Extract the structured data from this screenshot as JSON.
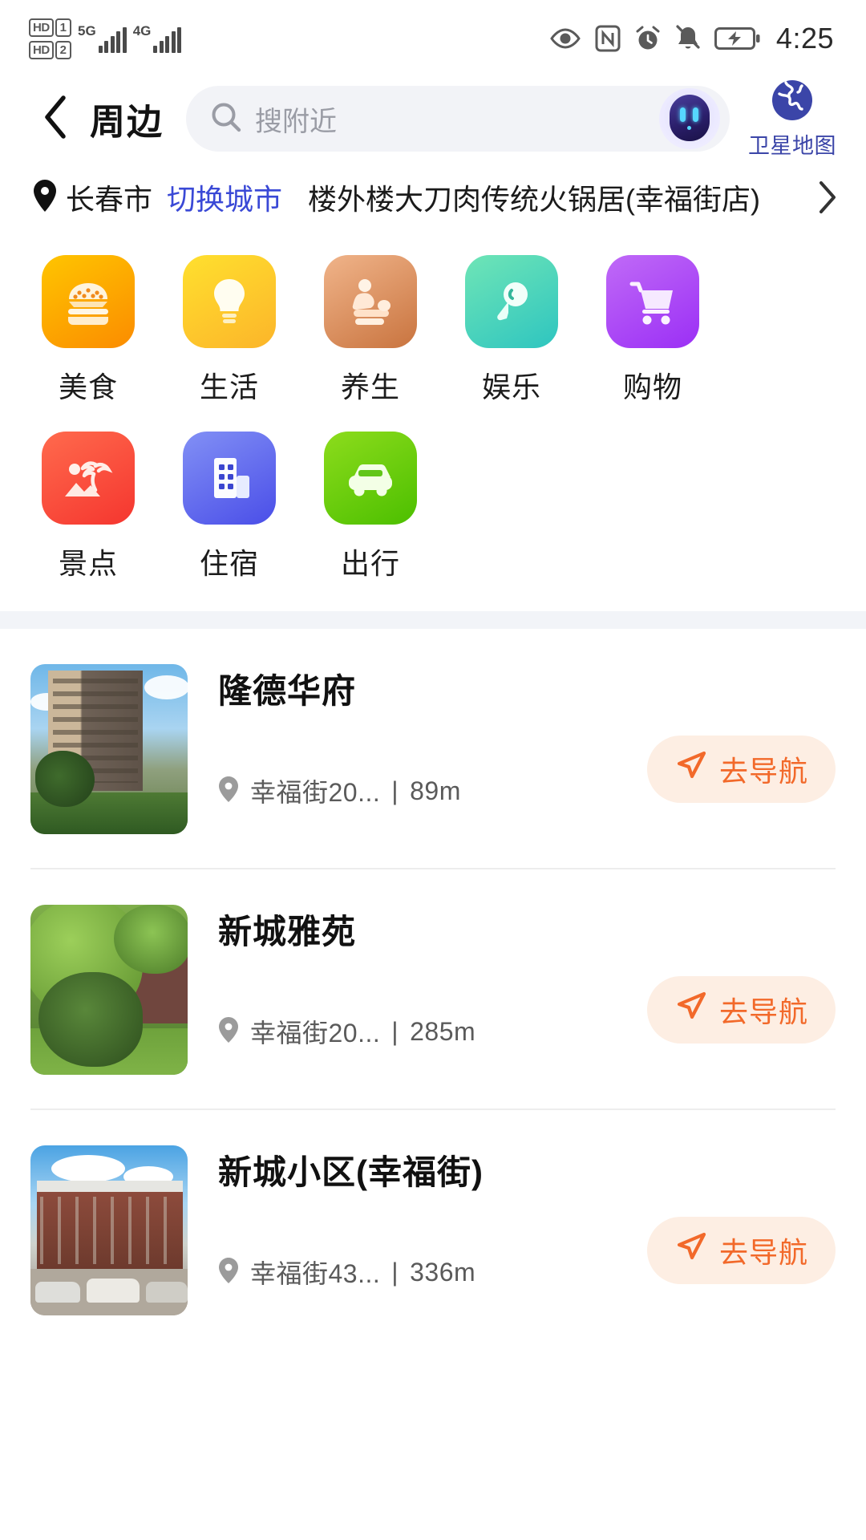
{
  "statusbar": {
    "sim1_hd": "HD",
    "sim1_num": "1",
    "sim2_hd": "HD",
    "sim2_num": "2",
    "net1": "5G",
    "net2": "4G",
    "time": "4:25",
    "icons": [
      "eye-care-icon",
      "nfc-icon",
      "alarm-icon",
      "bell-muted-icon",
      "battery-charging-icon"
    ]
  },
  "nav": {
    "back_icon": "chevron-left-icon",
    "title": "周边",
    "search": {
      "placeholder": "搜附近",
      "value": "",
      "icon": "search-icon",
      "assistant_icon": "ai-robot-icon"
    },
    "satellite": {
      "label": "卫星地图",
      "icon": "globe-icon"
    }
  },
  "location": {
    "pin_icon": "location-pin-icon",
    "city": "长春市",
    "switch_label": "切换城市",
    "poi": "楼外楼大刀肉传统火锅居(幸福街店)",
    "arrow_icon": "chevron-right-icon"
  },
  "categories": [
    {
      "label": "美食",
      "icon": "burger-icon",
      "color_start": "#ffc500",
      "color_end": "#fb8c00"
    },
    {
      "label": "生活",
      "icon": "lightbulb-icon",
      "color_start": "#ffe02e",
      "color_end": "#fcb52a"
    },
    {
      "label": "养生",
      "icon": "massage-icon",
      "color_start": "#f0b48a",
      "color_end": "#c9743f"
    },
    {
      "label": "娱乐",
      "icon": "microphone-icon",
      "color_start": "#6fe5b6",
      "color_end": "#2ec5c0"
    },
    {
      "label": "购物",
      "icon": "cart-icon",
      "color_start": "#c06af7",
      "color_end": "#9b2ff5"
    },
    {
      "label": "景点",
      "icon": "palm-beach-icon",
      "color_start": "#ff6a4d",
      "color_end": "#f5362f"
    },
    {
      "label": "住宿",
      "icon": "building-icon",
      "color_start": "#8290f5",
      "color_end": "#4a4ee8"
    },
    {
      "label": "出行",
      "icon": "car-icon",
      "color_start": "#8ddc1c",
      "color_end": "#4cbf00"
    }
  ],
  "poi_list": [
    {
      "name": "隆德华府",
      "address": "幸福街20...",
      "distance": "89m",
      "nav_label": "去导航",
      "nav_icon": "navigate-icon",
      "thumb": "apartment-photo"
    },
    {
      "name": "新城雅苑",
      "address": "幸福街20...",
      "distance": "285m",
      "nav_label": "去导航",
      "nav_icon": "navigate-icon",
      "thumb": "garden-photo"
    },
    {
      "name": "新城小区(幸福街)",
      "address": "幸福街43...",
      "distance": "336m",
      "nav_label": "去导航",
      "nav_icon": "navigate-icon",
      "thumb": "residence-photo"
    }
  ],
  "theme": {
    "accent_orange": "#f2692a",
    "accent_blue": "#3a49d6",
    "nav_btn_bg": "#fdeee3",
    "separator": "#f2f4f8"
  }
}
